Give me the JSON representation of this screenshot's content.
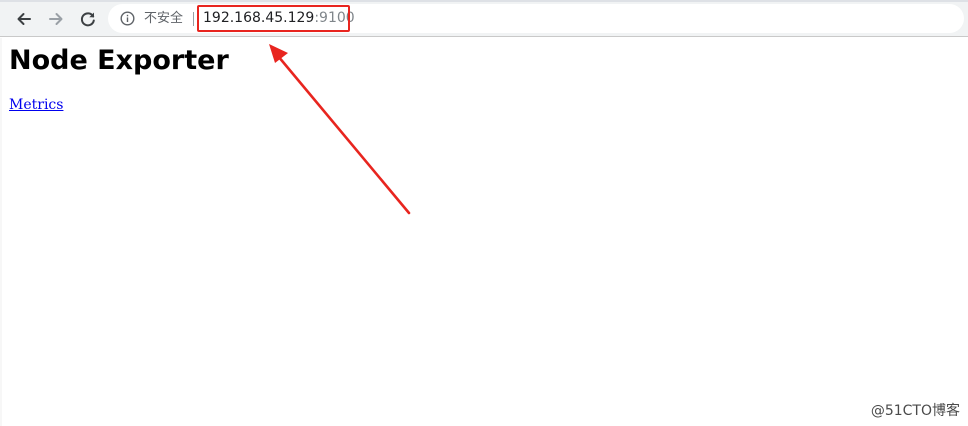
{
  "toolbar": {
    "security_label": "不安全",
    "url_host": "192.168.45.129",
    "url_port": ":9100"
  },
  "page": {
    "heading": "Node Exporter",
    "link_label": "Metrics"
  },
  "annotation": {
    "highlight_color": "#e8251f"
  },
  "watermark": {
    "text": "@51CTO博客"
  }
}
